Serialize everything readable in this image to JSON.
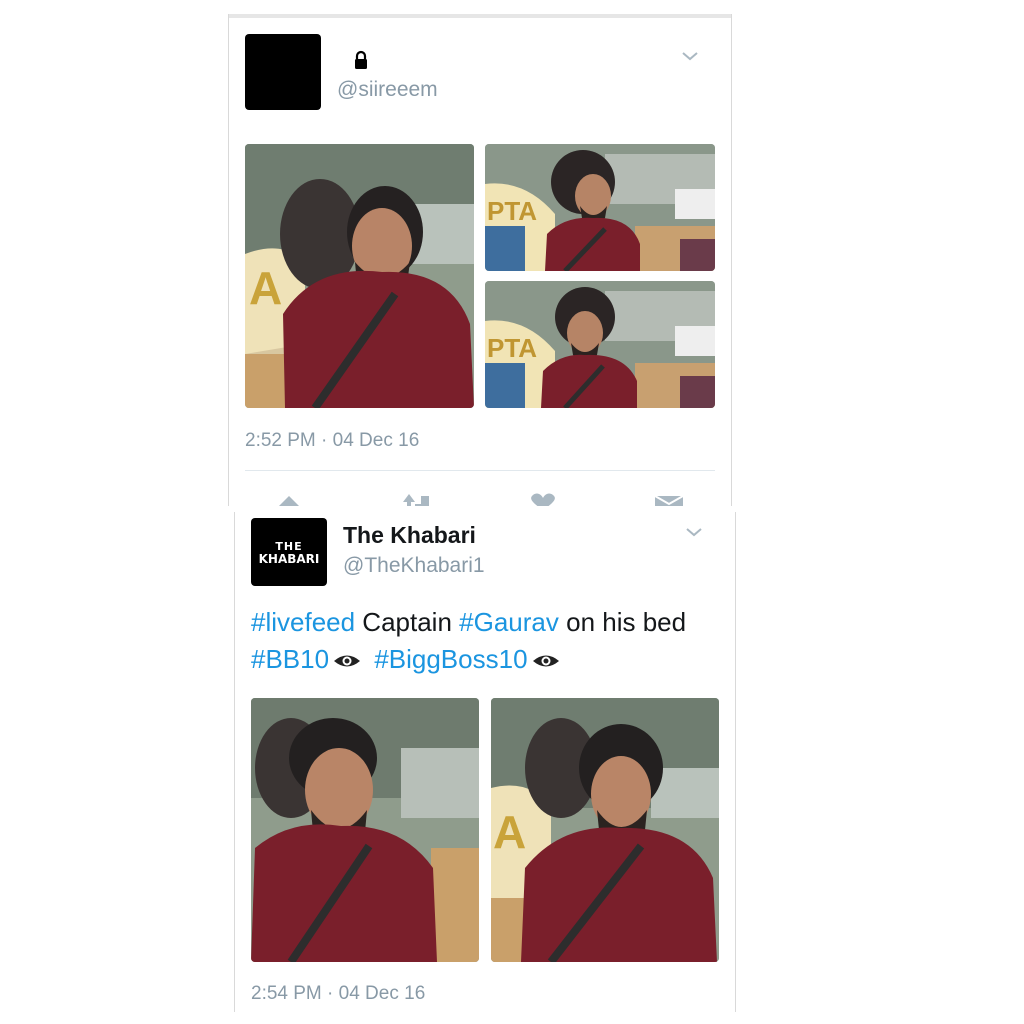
{
  "tweet1": {
    "handle": "@siireeem",
    "timestamp": "2:52 PM · 04 Dec 16",
    "photos": [
      "photo-large",
      "photo-top-right",
      "photo-bottom-right"
    ]
  },
  "tweet2": {
    "display_name": "The Khabari",
    "handle": "@TheKhabari1",
    "avatar_text_line1": "THE",
    "avatar_text_line2": "KHABARI",
    "text": {
      "tag1": "#livefeed",
      "word1": " Captain ",
      "tag2": "#Gaurav",
      "word2": " on his bed",
      "tag3": "#BB10",
      "tag4": "#BiggBoss10"
    },
    "timestamp": "2:54 PM · 04 Dec 16"
  },
  "colors": {
    "link": "#1b95e0",
    "muted": "#8899a6",
    "text": "#14171a",
    "shirt": "#7a1f2b"
  },
  "icons": [
    "lock-icon",
    "chevron-down-icon",
    "reply-icon",
    "retweet-icon",
    "like-icon",
    "message-icon",
    "eye-icon"
  ]
}
